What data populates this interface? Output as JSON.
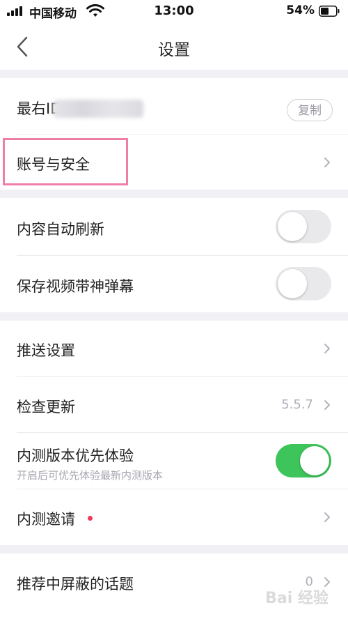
{
  "status_bar": {
    "carrier": "中国移动",
    "time": "13:00",
    "battery_percent": "54%",
    "battery_level": 0.54,
    "icons": [
      "signal-icon",
      "wifi-icon",
      "battery-icon"
    ]
  },
  "nav": {
    "title": "设置",
    "back_icon": "chevron-left-icon"
  },
  "account_section": {
    "id_label": "最右ID",
    "copy_label": "复制",
    "account_security_label": "账号与安全"
  },
  "content_section": {
    "auto_refresh_label": "内容自动刷新",
    "auto_refresh_on": false,
    "save_video_danmaku_label": "保存视频带神弹幕",
    "save_video_danmaku_on": false
  },
  "general_section": {
    "push_settings_label": "推送设置",
    "check_update_label": "检查更新",
    "version": "5.5.7",
    "beta_label": "内测版本优先体验",
    "beta_sub": "开启后可优先体验最新内测版本",
    "beta_on": true,
    "beta_invite_label": "内测邀请"
  },
  "topics_section": {
    "blocked_topics_label": "推荐中屏蔽的话题",
    "blocked_topics_count": "0"
  },
  "colors": {
    "toggle_on": "#3dc45a",
    "toggle_off": "#e9e9ec",
    "section_gap": "#f1f1f5",
    "highlight": "#ef7fa6",
    "red_dot": "#f2385f"
  },
  "watermark": "Bai 经验"
}
